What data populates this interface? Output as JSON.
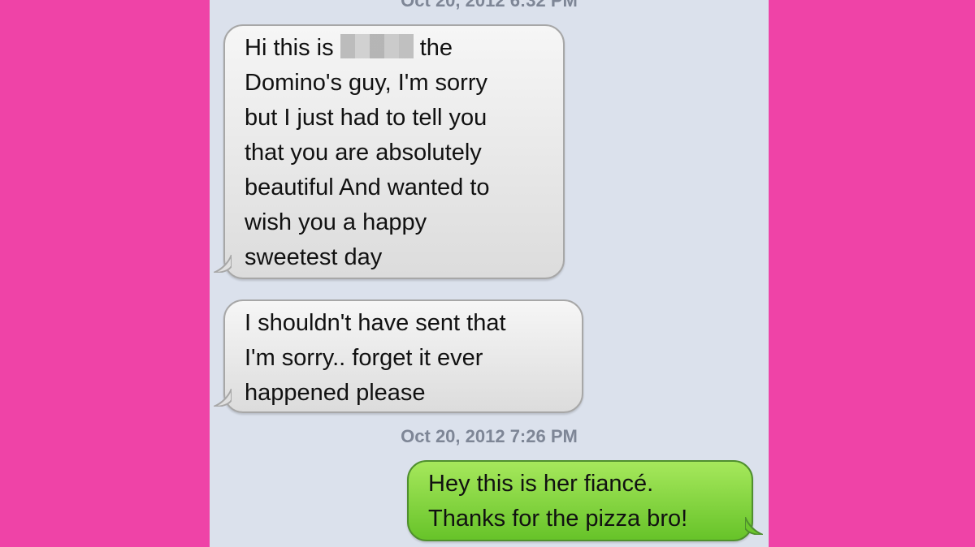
{
  "conversation": {
    "timestamp_top": "Oct 20, 2012 6:32 PM",
    "timestamp_mid": "Oct 20, 2012 7:26 PM",
    "messages": [
      {
        "direction": "incoming",
        "lines": [
          "Hi this is",
          "the",
          "Domino's guy, I'm sorry",
          "but I just had to tell you",
          "that you are absolutely",
          "beautiful And wanted to",
          "wish you a happy",
          "sweetest day"
        ]
      },
      {
        "direction": "incoming",
        "lines": [
          "I shouldn't have sent that",
          "I'm sorry.. forget it ever",
          "happened please"
        ]
      },
      {
        "direction": "outgoing",
        "lines": [
          "Hey this is her fiancé.",
          "Thanks for the pizza bro!"
        ]
      }
    ]
  },
  "colors": {
    "page_background": "#ef43a7",
    "screen_background": "#dbe1ec",
    "incoming_bubble": "#e9e9e9",
    "outgoing_bubble": "#82d43f",
    "timestamp_text": "#7e8696"
  }
}
